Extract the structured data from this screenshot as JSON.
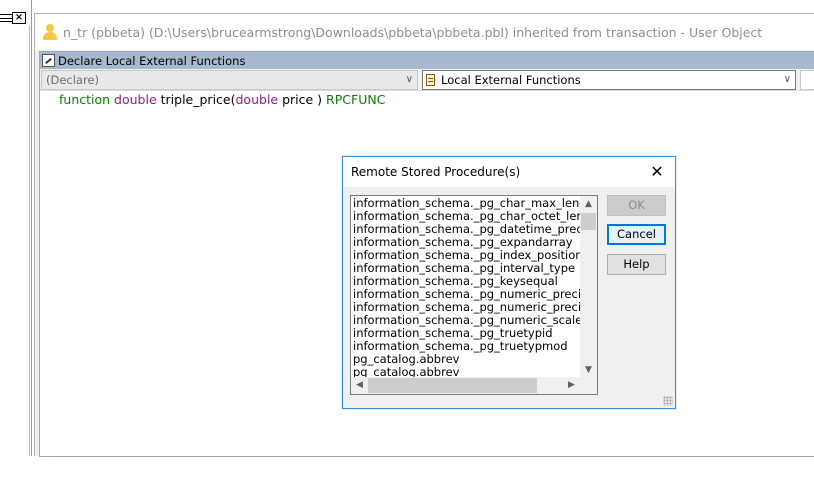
{
  "mdi": {
    "close_glyph": "×"
  },
  "window": {
    "title": "n_tr (pbbeta) (D:\\Users\\brucearmstrong\\Downloads\\pbbeta\\pbbeta.pbl) inherited from transaction - User Object"
  },
  "editor": {
    "caption": "Declare Local External Functions",
    "declare_combo_value": "(Declare)",
    "function_combo_value": "Local External Functions",
    "code": {
      "kw_function": "function",
      "type_return": "double",
      "name": "triple_price(",
      "type_param": "double",
      "param_rest": "price )",
      "kw_rpc": "RPCFUNC"
    }
  },
  "dialog": {
    "title": "Remote Stored Procedure(s)",
    "items": [
      "information_schema._pg_char_max_length",
      "information_schema._pg_char_octet_length",
      "information_schema._pg_datetime_precision",
      "information_schema._pg_expandarray",
      "information_schema._pg_index_position",
      "information_schema._pg_interval_type",
      "information_schema._pg_keysequal",
      "information_schema._pg_numeric_precision",
      "information_schema._pg_numeric_precision_ra",
      "information_schema._pg_numeric_scale",
      "information_schema._pg_truetypid",
      "information_schema._pg_truetypmod",
      "pg_catalog.abbrev",
      "pg_catalog.abbrev"
    ],
    "buttons": {
      "ok": "OK",
      "cancel": "Cancel",
      "help": "Help"
    }
  },
  "colors": {
    "keyword": "#0a7a0a",
    "type": "#8a1e8a",
    "caption_bg": "#a6b9cf",
    "dialog_border": "#3c8fd6"
  }
}
